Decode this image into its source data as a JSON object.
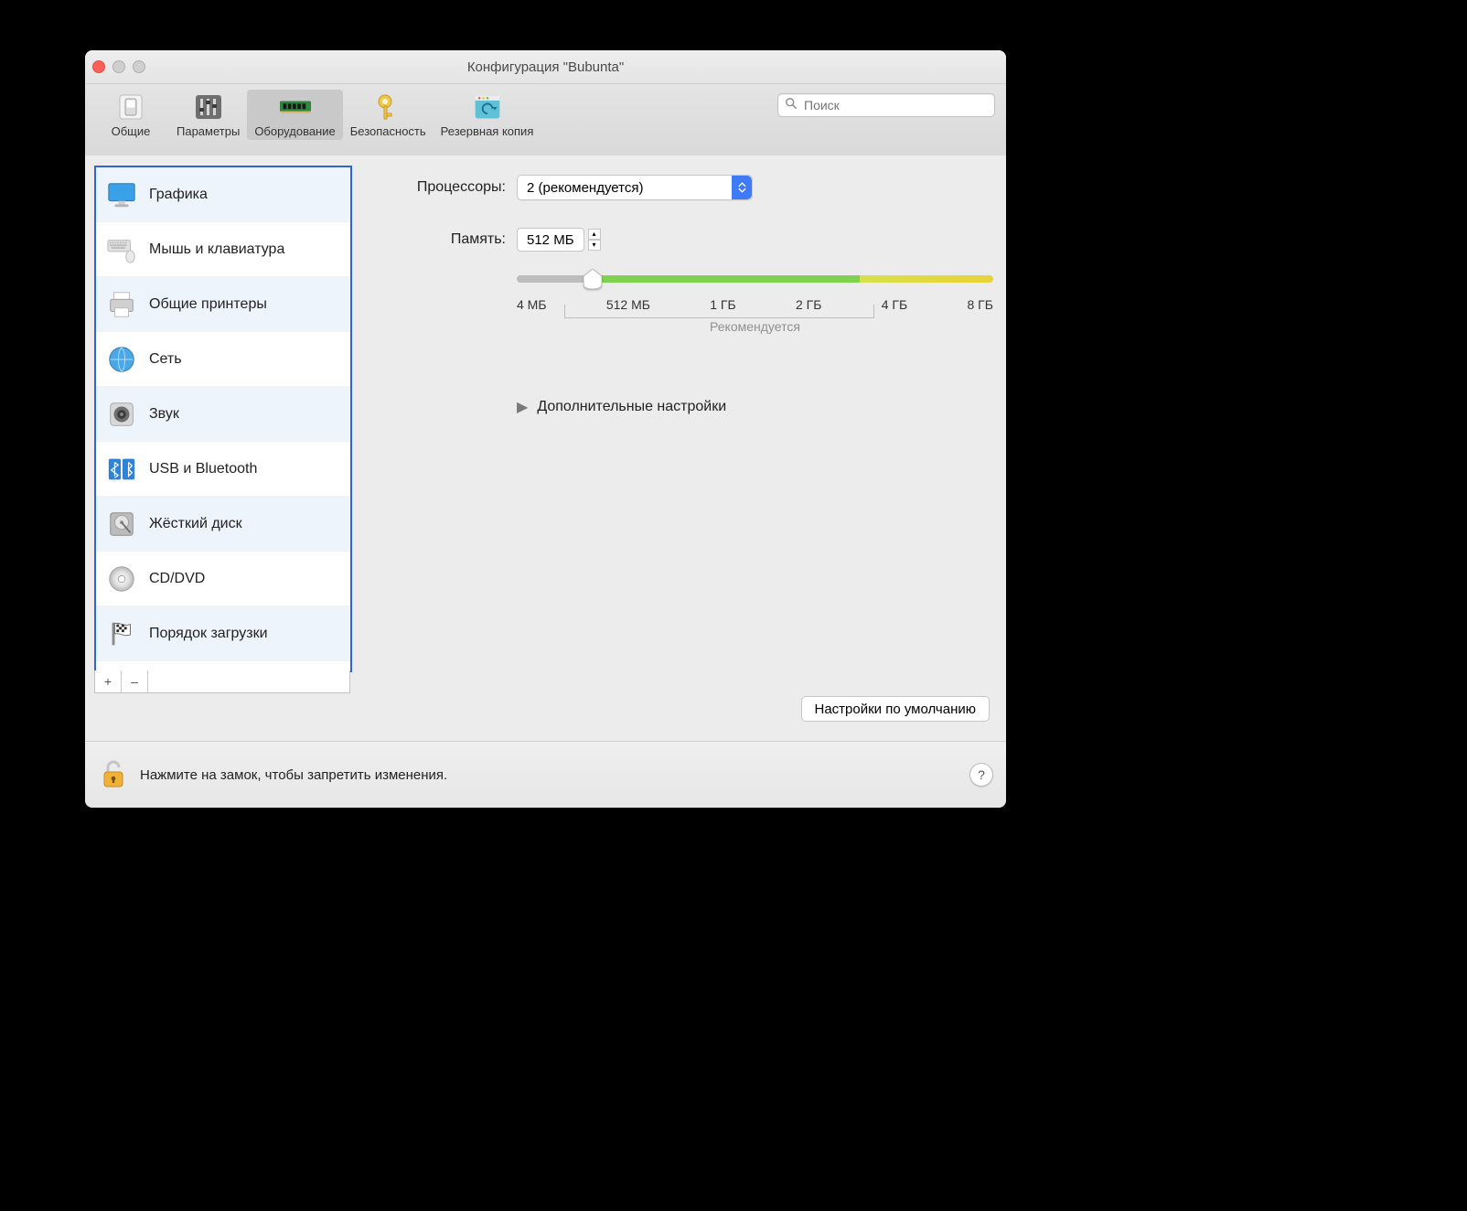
{
  "window": {
    "title": "Конфигурация \"Bubunta\""
  },
  "toolbar": {
    "tabs": [
      {
        "label": "Общие"
      },
      {
        "label": "Параметры"
      },
      {
        "label": "Оборудование"
      },
      {
        "label": "Безопасность"
      },
      {
        "label": "Резервная копия"
      }
    ],
    "active_index": 2,
    "search_placeholder": "Поиск"
  },
  "sidebar": {
    "items": [
      {
        "label": "Графика"
      },
      {
        "label": "Мышь и клавиатура"
      },
      {
        "label": "Общие принтеры"
      },
      {
        "label": "Сеть"
      },
      {
        "label": "Звук"
      },
      {
        "label": "USB и Bluetooth"
      },
      {
        "label": "Жёсткий диск"
      },
      {
        "label": "CD/DVD"
      },
      {
        "label": "Порядок загрузки"
      }
    ],
    "add_label": "+",
    "remove_label": "–"
  },
  "settings": {
    "cpu": {
      "label": "Процессоры:",
      "value": "2 (рекомендуется)"
    },
    "memory": {
      "label": "Память:",
      "value": "512 МБ",
      "ticks": [
        "4 МБ",
        "512 МБ",
        "1 ГБ",
        "2 ГБ",
        "4 ГБ",
        "8 ГБ"
      ],
      "recommended_label": "Рекомендуется"
    },
    "advanced_label": "Дополнительные настройки",
    "defaults_button": "Настройки по умолчанию"
  },
  "footer": {
    "message": "Нажмите на замок, чтобы запретить изменения.",
    "help": "?"
  }
}
